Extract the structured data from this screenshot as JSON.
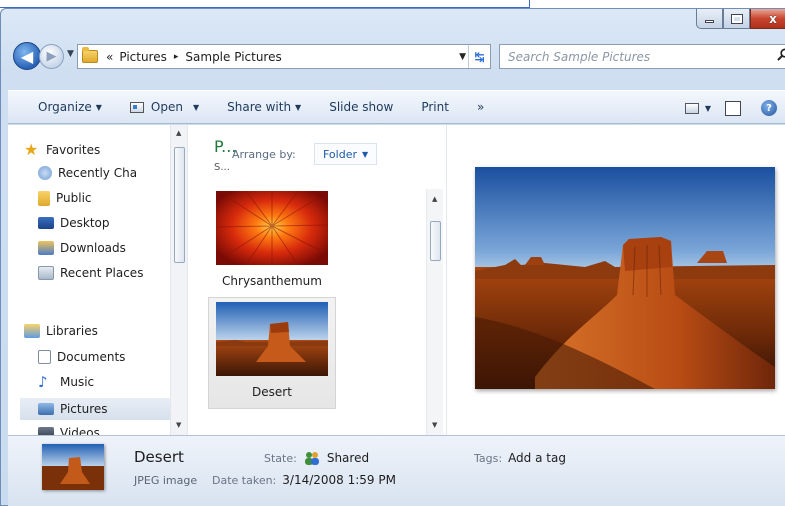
{
  "window": {
    "caption_minimize": "minimize",
    "caption_maximize": "maximize",
    "caption_close": "x"
  },
  "address_bar": {
    "overflow": "«",
    "crumbs": [
      "Pictures",
      "Sample Pictures"
    ],
    "separator": "▸",
    "search_placeholder": "Search Sample Pictures"
  },
  "command_bar": {
    "organize": "Organize",
    "open": "Open",
    "share_with": "Share with",
    "slide_show": "Slide show",
    "print": "Print",
    "more": "»"
  },
  "nav_pane": {
    "favorites": {
      "label": "Favorites",
      "items": [
        "Recently Cha",
        "Public",
        "Desktop",
        "Downloads",
        "Recent Places"
      ]
    },
    "libraries": {
      "label": "Libraries",
      "items": [
        "Documents",
        "Music",
        "Pictures",
        "Videos"
      ]
    }
  },
  "file_pane": {
    "library_title": "P...",
    "library_subtitle": "S...",
    "arrange_label": "Arrange by:",
    "arrange_value": "Folder",
    "files": [
      {
        "name": "Chrysanthemum",
        "selected": false
      },
      {
        "name": "Desert",
        "selected": true
      }
    ]
  },
  "details": {
    "name": "Desert",
    "type": "JPEG image",
    "state_label": "State:",
    "state_value": "Shared",
    "date_label": "Date taken:",
    "date_value": "3/14/2008 1:59 PM",
    "tags_label": "Tags:",
    "tags_value": "Add a tag"
  },
  "colors": {
    "accent": "#1e5aa8",
    "library_title": "#1e7a3a",
    "close_button": "#c9452f"
  }
}
